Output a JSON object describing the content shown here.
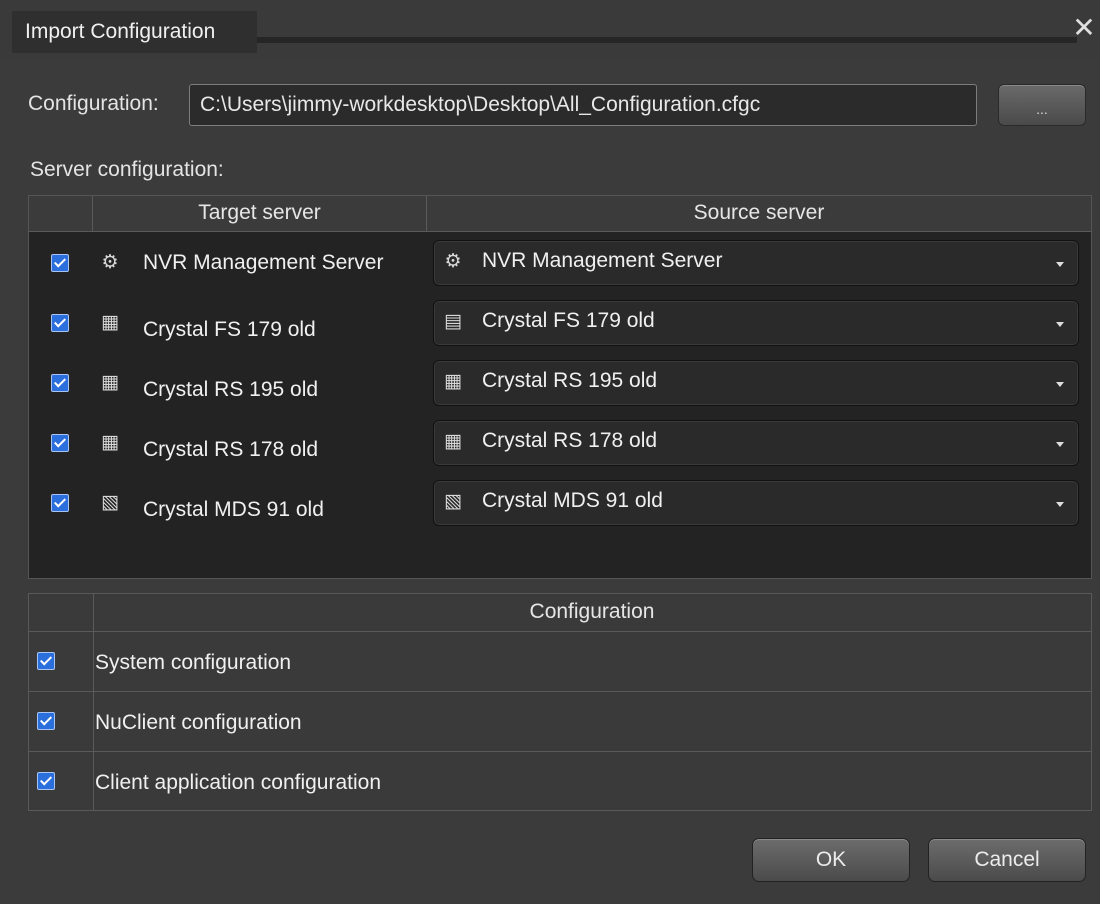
{
  "window": {
    "title": "Import Configuration",
    "close_glyph": "✕"
  },
  "configuration": {
    "label": "Configuration:",
    "path": "C:\\Users\\jimmy-workdesktop\\Desktop\\All_Configuration.cfgc",
    "browse_label": "..."
  },
  "server_section": {
    "label": "Server configuration:",
    "headers": {
      "target": "Target server",
      "source": "Source server"
    },
    "rows": [
      {
        "checked": true,
        "target_icon": "management-server-icon",
        "target": "NVR Management Server",
        "source_icon": "management-server-icon",
        "source": "NVR Management Server"
      },
      {
        "checked": true,
        "target_icon": "recording-server-icon",
        "target": "Crystal FS 179 old",
        "source_icon": "failover-server-icon",
        "source": "Crystal FS 179 old"
      },
      {
        "checked": true,
        "target_icon": "recording-server-icon",
        "target": "Crystal RS 195 old",
        "source_icon": "recording-server-icon",
        "source": "Crystal RS 195 old"
      },
      {
        "checked": true,
        "target_icon": "recording-server-icon",
        "target": "Crystal RS 178 old",
        "source_icon": "recording-server-icon",
        "source": "Crystal RS 178 old"
      },
      {
        "checked": true,
        "target_icon": "media-distribution-server-icon",
        "target": "Crystal MDS 91 old",
        "source_icon": "media-distribution-server-icon",
        "source": "Crystal MDS 91 old"
      }
    ]
  },
  "config_section": {
    "header": "Configuration",
    "rows": [
      {
        "checked": true,
        "label": "System configuration"
      },
      {
        "checked": true,
        "label": "NuClient configuration"
      },
      {
        "checked": true,
        "label": "Client application configuration"
      }
    ]
  },
  "buttons": {
    "ok": "OK",
    "cancel": "Cancel"
  },
  "icon_glyphs": {
    "management-server-icon": "⚙",
    "recording-server-icon": "▦",
    "failover-server-icon": "▤",
    "media-distribution-server-icon": "▧"
  },
  "colors": {
    "accent_checkbox": "#2b6fdc",
    "panel_dark": "#232323",
    "dialog_bg": "#3b3b3b"
  }
}
